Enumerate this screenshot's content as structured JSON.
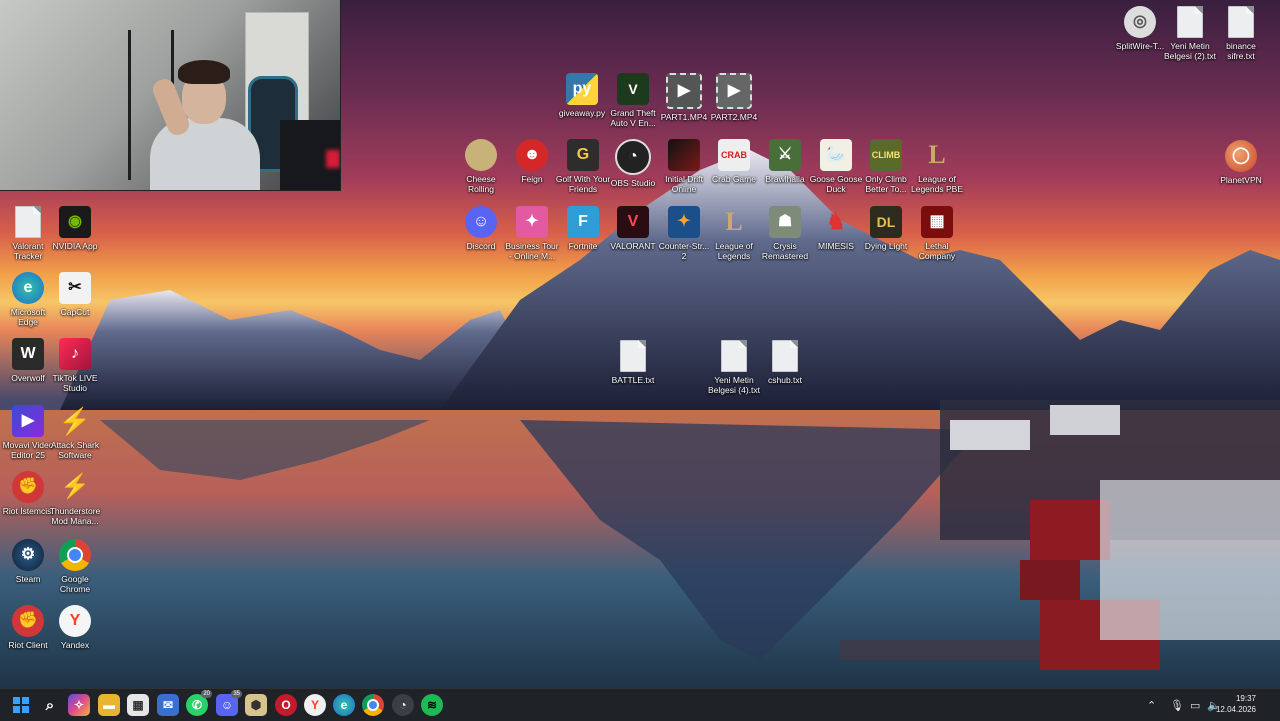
{
  "desktop": {
    "icons_left": [
      {
        "label": "Valorant Tracker",
        "icon": "file-icon"
      },
      {
        "label": "NVIDIA App",
        "icon": "nvidia-icon"
      },
      {
        "label": "Microsoft Edge",
        "icon": "edge-icon"
      },
      {
        "label": "CapCut",
        "icon": "capcut-icon"
      },
      {
        "label": "Overwolf",
        "icon": "overwolf-icon"
      },
      {
        "label": "TikTok LIVE Studio",
        "icon": "tiktok-icon"
      },
      {
        "label": "Movavi Video Editor 25",
        "icon": "movavi-icon"
      },
      {
        "label": "Attack Shark Software",
        "icon": "attack-shark-icon"
      },
      {
        "label": "Riot İstemcisi",
        "icon": "riot-icon"
      },
      {
        "label": "Thunderstore Mod Mana...",
        "icon": "thunderstore-icon"
      },
      {
        "label": "Steam",
        "icon": "steam-icon"
      },
      {
        "label": "Google Chrome",
        "icon": "chrome-icon"
      },
      {
        "label": "Riot Client",
        "icon": "riot-icon"
      },
      {
        "label": "Yandex",
        "icon": "yandex-icon"
      }
    ],
    "icons_center_row1": [
      {
        "label": "giveaway.py",
        "icon": "python-icon"
      },
      {
        "label": "Grand Theft Auto V En...",
        "icon": "gta-icon"
      },
      {
        "label": "PART1.MP4",
        "icon": "video-icon"
      },
      {
        "label": "PART2.MP4",
        "icon": "video-icon"
      }
    ],
    "icons_center_row2": [
      {
        "label": "Cheese Rolling",
        "icon": "cheese-icon"
      },
      {
        "label": "Feign",
        "icon": "feign-icon"
      },
      {
        "label": "Golf With Your Friends",
        "icon": "golf-icon"
      },
      {
        "label": "OBS Studio",
        "icon": "obs-icon"
      },
      {
        "label": "Initial Drift Online",
        "icon": "drift-icon"
      },
      {
        "label": "Crab Game",
        "icon": "crab-icon"
      },
      {
        "label": "Brawlhalla",
        "icon": "brawlhalla-icon"
      },
      {
        "label": "Goose Goose Duck",
        "icon": "goose-icon"
      },
      {
        "label": "Only Climb Better To...",
        "icon": "climb-icon"
      },
      {
        "label": "League of Legends PBE",
        "icon": "lol-icon"
      }
    ],
    "icons_center_row3": [
      {
        "label": "Discord",
        "icon": "discord-icon"
      },
      {
        "label": "Business Tour - Online M...",
        "icon": "business-tour-icon"
      },
      {
        "label": "Fortnite",
        "icon": "fortnite-icon"
      },
      {
        "label": "VALORANT",
        "icon": "valorant-icon"
      },
      {
        "label": "Counter-Str... 2",
        "icon": "cs2-icon"
      },
      {
        "label": "League of Legends",
        "icon": "lol-icon"
      },
      {
        "label": "Crysis Remastered",
        "icon": "crysis-icon"
      },
      {
        "label": "MIMESIS",
        "icon": "mimesis-icon"
      },
      {
        "label": "Dying Light",
        "icon": "dying-light-icon"
      },
      {
        "label": "Lethal Company",
        "icon": "lethal-company-icon"
      }
    ],
    "icons_center_row4": [
      {
        "label": "BATTLE.txt",
        "icon": "file-icon"
      },
      {
        "label": "Yeni Metin Belgesi (4).txt",
        "icon": "file-icon"
      },
      {
        "label": "cshub.txt",
        "icon": "file-icon"
      }
    ],
    "icons_right": [
      {
        "label": "SplitWire-T...",
        "icon": "splitwire-icon"
      },
      {
        "label": "Yeni Metin Belgesi (2).txt",
        "icon": "file-icon"
      },
      {
        "label": "binance sifre.txt",
        "icon": "file-icon"
      },
      {
        "label": "PlanetVPN",
        "icon": "planetvpn-icon"
      }
    ]
  },
  "taskbar": {
    "whatsapp_badge": "20",
    "discord_badge": "35",
    "time": "19:37",
    "date": "12.04.2026"
  },
  "colors": {
    "taskbar_bg": "#1f2328",
    "accent": "#0078d4"
  }
}
